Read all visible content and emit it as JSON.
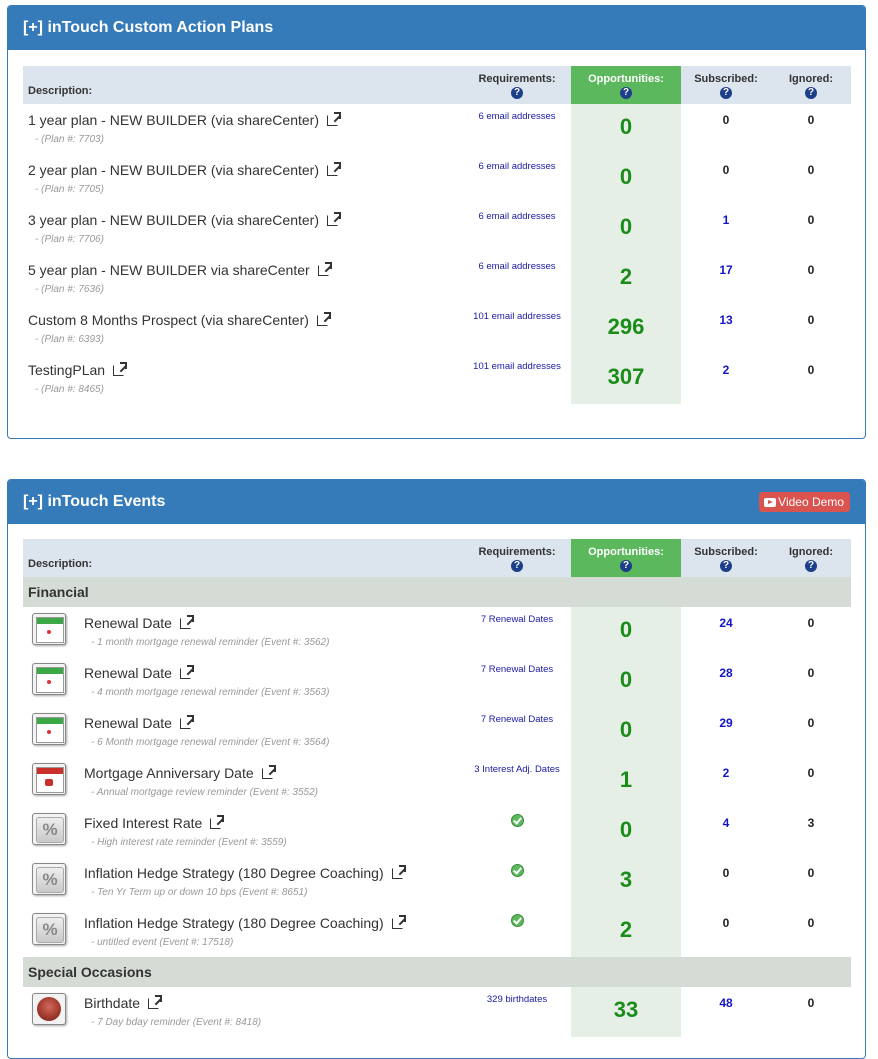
{
  "plans_panel": {
    "title": "[+] inTouch Custom Action Plans",
    "headers": {
      "description": "Description:",
      "requirements": "Requirements:",
      "opportunities": "Opportunities:",
      "subscribed": "Subscribed:",
      "ignored": "Ignored:",
      "help_glyph": "?"
    },
    "rows": [
      {
        "name": "1 year plan - NEW BUILDER (via shareCenter)",
        "sub": "- (Plan #: 7703)",
        "requirements": "6 email addresses",
        "opportunities": "0",
        "subscribed": "0",
        "ignored": "0"
      },
      {
        "name": "2 year plan - NEW BUILDER (via shareCenter)",
        "sub": "- (Plan #: 7705)",
        "requirements": "6 email addresses",
        "opportunities": "0",
        "subscribed": "0",
        "ignored": "0"
      },
      {
        "name": "3 year plan - NEW BUILDER (via shareCenter)",
        "sub": "- (Plan #: 7706)",
        "requirements": "6 email addresses",
        "opportunities": "0",
        "subscribed": "1",
        "ignored": "0"
      },
      {
        "name": "5 year plan - NEW BUILDER via shareCenter",
        "sub": "- (Plan #: 7636)",
        "requirements": "6 email addresses",
        "opportunities": "2",
        "subscribed": "17",
        "ignored": "0"
      },
      {
        "name": "Custom 8 Months Prospect (via shareCenter)",
        "sub": "- (Plan #: 6393)",
        "requirements": "101 email addresses",
        "opportunities": "296",
        "subscribed": "13",
        "ignored": "0"
      },
      {
        "name": "TestingPLan",
        "sub": "- (Plan #: 8465)",
        "requirements": "101 email addresses",
        "opportunities": "307",
        "subscribed": "2",
        "ignored": "0"
      }
    ]
  },
  "events_panel": {
    "title": "[+] inTouch Events",
    "video_button": "Video Demo",
    "headers": {
      "description": "Description:",
      "requirements": "Requirements:",
      "opportunities": "Opportunities:",
      "subscribed": "Subscribed:",
      "ignored": "Ignored:",
      "help_glyph": "?"
    },
    "categories": [
      {
        "name": "Financial",
        "rows": [
          {
            "icon": "renewal-calendar-icon",
            "name": "Renewal Date",
            "sub": "- 1 month mortgage renewal reminder (Event #: 3562)",
            "requirements": "7 Renewal Dates",
            "opportunities": "0",
            "subscribed": "24",
            "ignored": "0"
          },
          {
            "icon": "renewal-calendar-icon",
            "name": "Renewal Date",
            "sub": "- 4 month mortgage renewal reminder (Event #: 3563)",
            "requirements": "7 Renewal Dates",
            "opportunities": "0",
            "subscribed": "28",
            "ignored": "0"
          },
          {
            "icon": "renewal-calendar-icon",
            "name": "Renewal Date",
            "sub": "- 6 Month mortgage renewal reminder (Event #: 3564)",
            "requirements": "7 Renewal Dates",
            "opportunities": "0",
            "subscribed": "29",
            "ignored": "0"
          },
          {
            "icon": "anniversary-calendar-icon",
            "name": "Mortgage Anniversary Date",
            "sub": "- Annual mortgage review reminder (Event #: 3552)",
            "requirements": "3 Interest Adj. Dates",
            "opportunities": "1",
            "subscribed": "2",
            "ignored": "0"
          },
          {
            "icon": "percent-icon",
            "name": "Fixed Interest Rate",
            "sub": "- High interest rate reminder (Event #: 3559)",
            "requirements": "",
            "opportunities": "0",
            "subscribed": "4",
            "ignored": "3"
          },
          {
            "icon": "percent-icon",
            "name": "Inflation Hedge Strategy (180 Degree Coaching)",
            "sub": "- Ten Yr Term up or down 10 bps (Event #: 8651)",
            "requirements": "",
            "opportunities": "3",
            "subscribed": "0",
            "ignored": "0"
          },
          {
            "icon": "percent-icon",
            "name": "Inflation Hedge Strategy (180 Degree Coaching)",
            "sub": "- untitled event (Event #: 17518)",
            "requirements": "",
            "opportunities": "2",
            "subscribed": "0",
            "ignored": "0"
          }
        ]
      },
      {
        "name": "Special Occasions",
        "rows": [
          {
            "icon": "birthday-cake-icon",
            "name": "Birthdate",
            "sub": "- 7 Day bday reminder (Event #: 8418)",
            "requirements": "329 birthdates",
            "opportunities": "33",
            "subscribed": "48",
            "ignored": "0"
          }
        ]
      }
    ]
  }
}
